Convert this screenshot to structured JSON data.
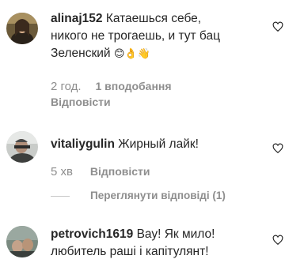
{
  "comments": [
    {
      "username": "alinaj152",
      "text_line1": "Катаешься себе,",
      "text_line2": "никого не трогаешь, и тут бац",
      "text_line3": "Зеленский",
      "emoji": "😊👌👋",
      "time": "2 год.",
      "likes": "1 вподобання",
      "reply": "Відповісти"
    },
    {
      "username": "vitaliygulin",
      "text": "Жирный лайк!",
      "time": "5 хв",
      "reply": "Відповісти",
      "view_replies": "Переглянути відповіді (1)"
    },
    {
      "username": "petrovich1619",
      "text_line1": "Вау! Як мило!",
      "text_line2": "любитель раші і капітулянт!"
    }
  ],
  "icons": {
    "like": "heart-outline-icon"
  }
}
